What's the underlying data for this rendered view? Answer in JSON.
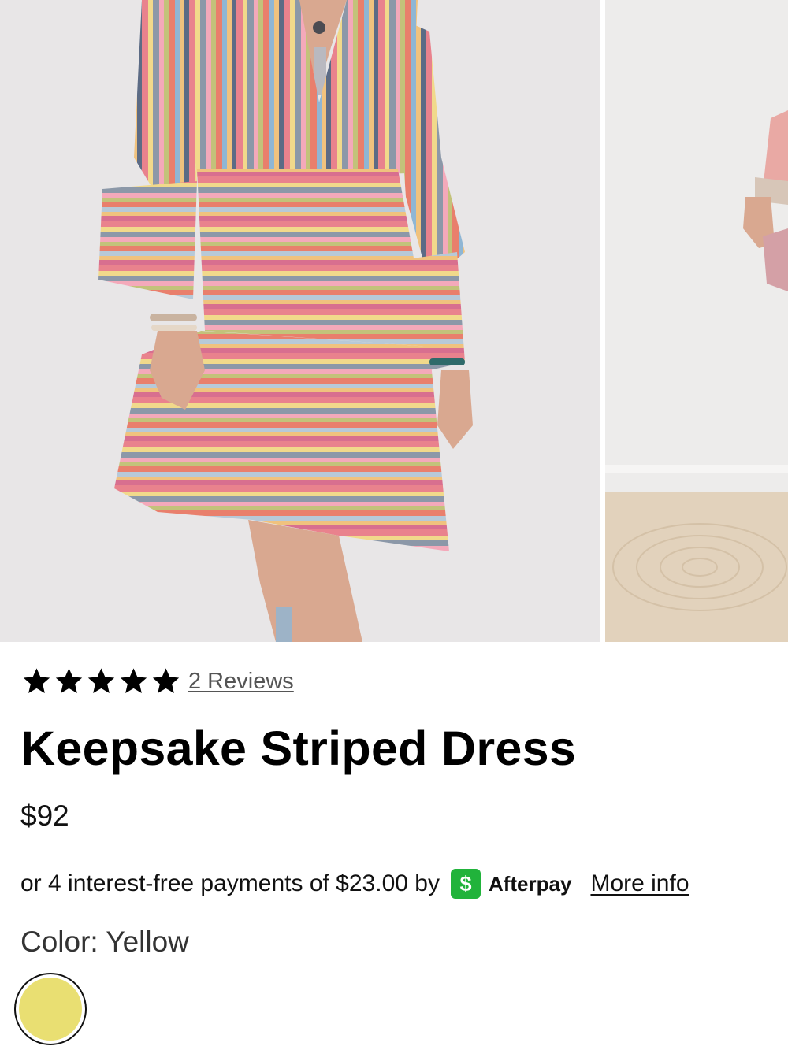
{
  "gallery": {
    "main_image_alt": "",
    "next_image_alt": ""
  },
  "product": {
    "rating": 5,
    "reviews_label": "2 Reviews",
    "title": "Keepsake Striped Dress",
    "price": "$92"
  },
  "afterpay": {
    "text": "or 4 interest-free payments of $23.00 by",
    "badge_symbol": "$",
    "brand": "Afterpay",
    "more_info": "More info",
    "badge_color": "#21b33b"
  },
  "color": {
    "label": "Color: Yellow",
    "swatch_hex": "#e9df72"
  },
  "icons": {
    "star": "star-icon",
    "afterpay": "afterpay-logo-icon"
  }
}
